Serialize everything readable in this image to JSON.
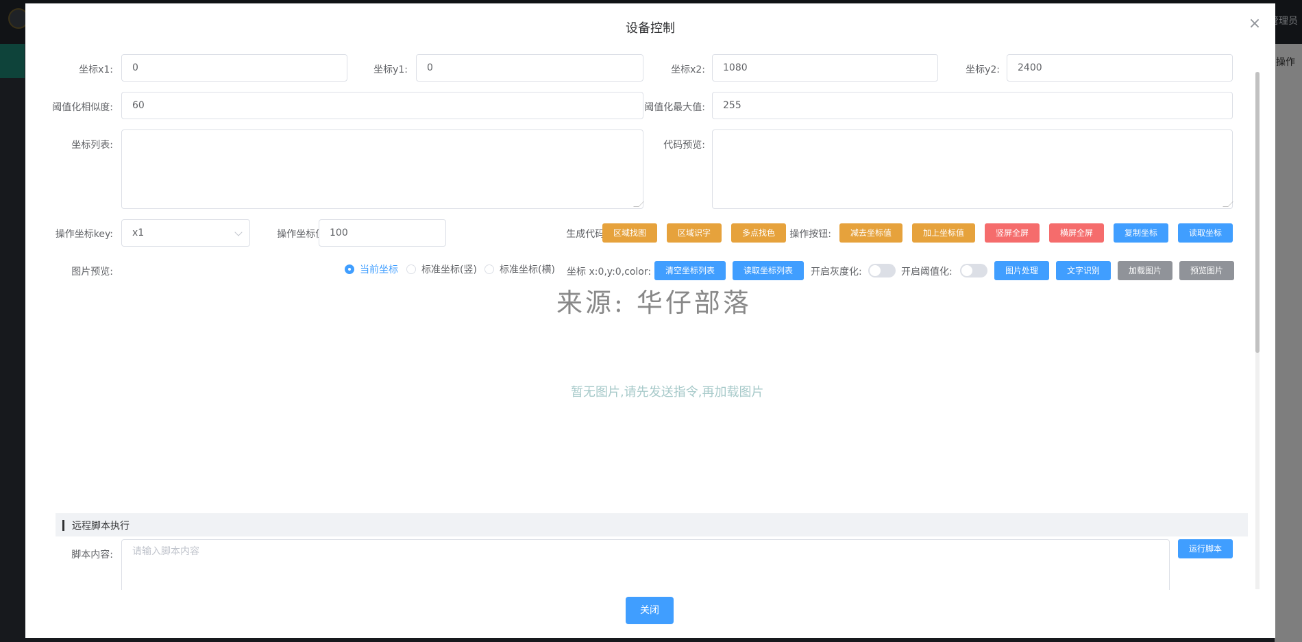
{
  "background": {
    "right_header_text": "管理员",
    "right_col_text": "操作"
  },
  "dialog": {
    "title": "设备控制",
    "close_symbol": "×"
  },
  "coords": {
    "x1_label": "坐标x1:",
    "x1_value": "0",
    "y1_label": "坐标y1:",
    "y1_value": "0",
    "x2_label": "坐标x2:",
    "x2_value": "1080",
    "y2_label": "坐标y2:",
    "y2_value": "2400"
  },
  "threshold": {
    "similarity_label": "阈值化相似度:",
    "similarity_value": "60",
    "max_label": "阈值化最大值:",
    "max_value": "255"
  },
  "lists": {
    "coord_list_label": "坐标列表:",
    "code_preview_label": "代码预览:"
  },
  "operate": {
    "key_label": "操作坐标key:",
    "key_value": "x1",
    "value_label": "操作坐标值:",
    "value_value": "100",
    "generate_label": "生成代码:",
    "buttons_label": "操作按钮:",
    "btn_region_find_image": "区域找图",
    "btn_region_ocr": "区域识字",
    "btn_multi_color": "多点找色",
    "btn_minus_coord": "减去坐标值",
    "btn_plus_coord": "加上坐标值",
    "btn_portrait_full": "竖屏全屏",
    "btn_landscape_full": "横屏全屏",
    "btn_copy_coord": "复制坐标",
    "btn_read_coord": "读取坐标"
  },
  "preview": {
    "label": "图片预览:",
    "radio_current": "当前坐标",
    "radio_portrait": "标准坐标(竖)",
    "radio_landscape": "标准坐标(横)",
    "coord_info": "坐标 x:0,y:0,color:",
    "btn_clear_list": "清空坐标列表",
    "btn_read_list": "读取坐标列表",
    "gray_label": "开启灰度化:",
    "threshold_label": "开启阈值化:",
    "btn_image_process": "图片处理",
    "btn_text_recog": "文字识别",
    "btn_load_image": "加载图片",
    "btn_preview_image": "预览图片",
    "watermark": "来源: 华仔部落",
    "empty_text": "暂无图片,请先发送指令,再加载图片"
  },
  "script": {
    "section_title": "远程脚本执行",
    "content_label": "脚本内容:",
    "content_placeholder": "请输入脚本内容",
    "btn_run": "运行脚本"
  },
  "footer": {
    "close_label": "关闭"
  },
  "colors": {
    "orange": "#e6a23c",
    "red": "#f56c6c",
    "blue": "#409eff",
    "gray": "#909399"
  }
}
